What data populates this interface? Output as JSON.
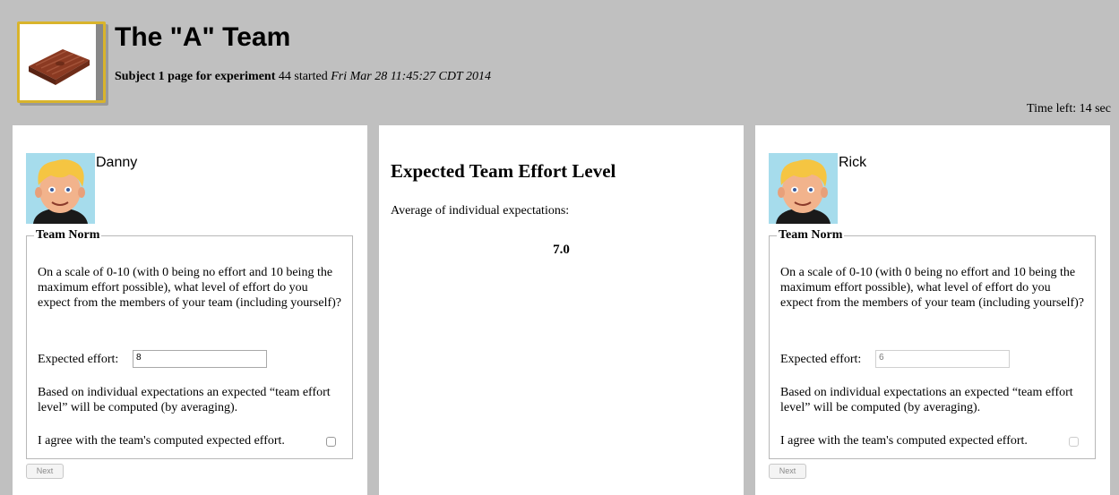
{
  "header": {
    "title": "The \"A\" Team",
    "subtitle_bold": "Subject 1 page for experiment",
    "subtitle_plain": " 44 started ",
    "subtitle_italic": "Fri Mar 28 11:45:27 CDT 2014",
    "time_left": "Time left: 14 sec"
  },
  "left_panel": {
    "name": "Danny",
    "legend": "Team Norm",
    "question": "On a scale of 0-10 (with 0 being no effort and 10 being the maximum effort possible), what level of effort do you expect from the members of your team (including yourself)?",
    "effort_label": "Expected effort:",
    "effort_value": "8",
    "note": "Based on individual expectations an expected “team effort level” will be computed (by averaging).",
    "agree_label": "I agree with the team's computed expected effort.",
    "agree_checked": false,
    "next_label": "Next"
  },
  "middle_panel": {
    "title": "Expected Team Effort Level",
    "subtitle": "Average of individual expectations:",
    "value": "7.0"
  },
  "right_panel": {
    "name": "Rick",
    "legend": "Team Norm",
    "question": "On a scale of 0-10 (with 0 being no effort and 10 being the maximum effort possible), what level of effort do you expect from the members of your team (including yourself)?",
    "effort_label": "Expected effort:",
    "effort_value": "6",
    "note": "Based on individual expectations an expected “team effort level” will be computed (by averaging).",
    "agree_label": "I agree with the team's computed expected effort.",
    "agree_checked": false,
    "next_label": "Next"
  }
}
